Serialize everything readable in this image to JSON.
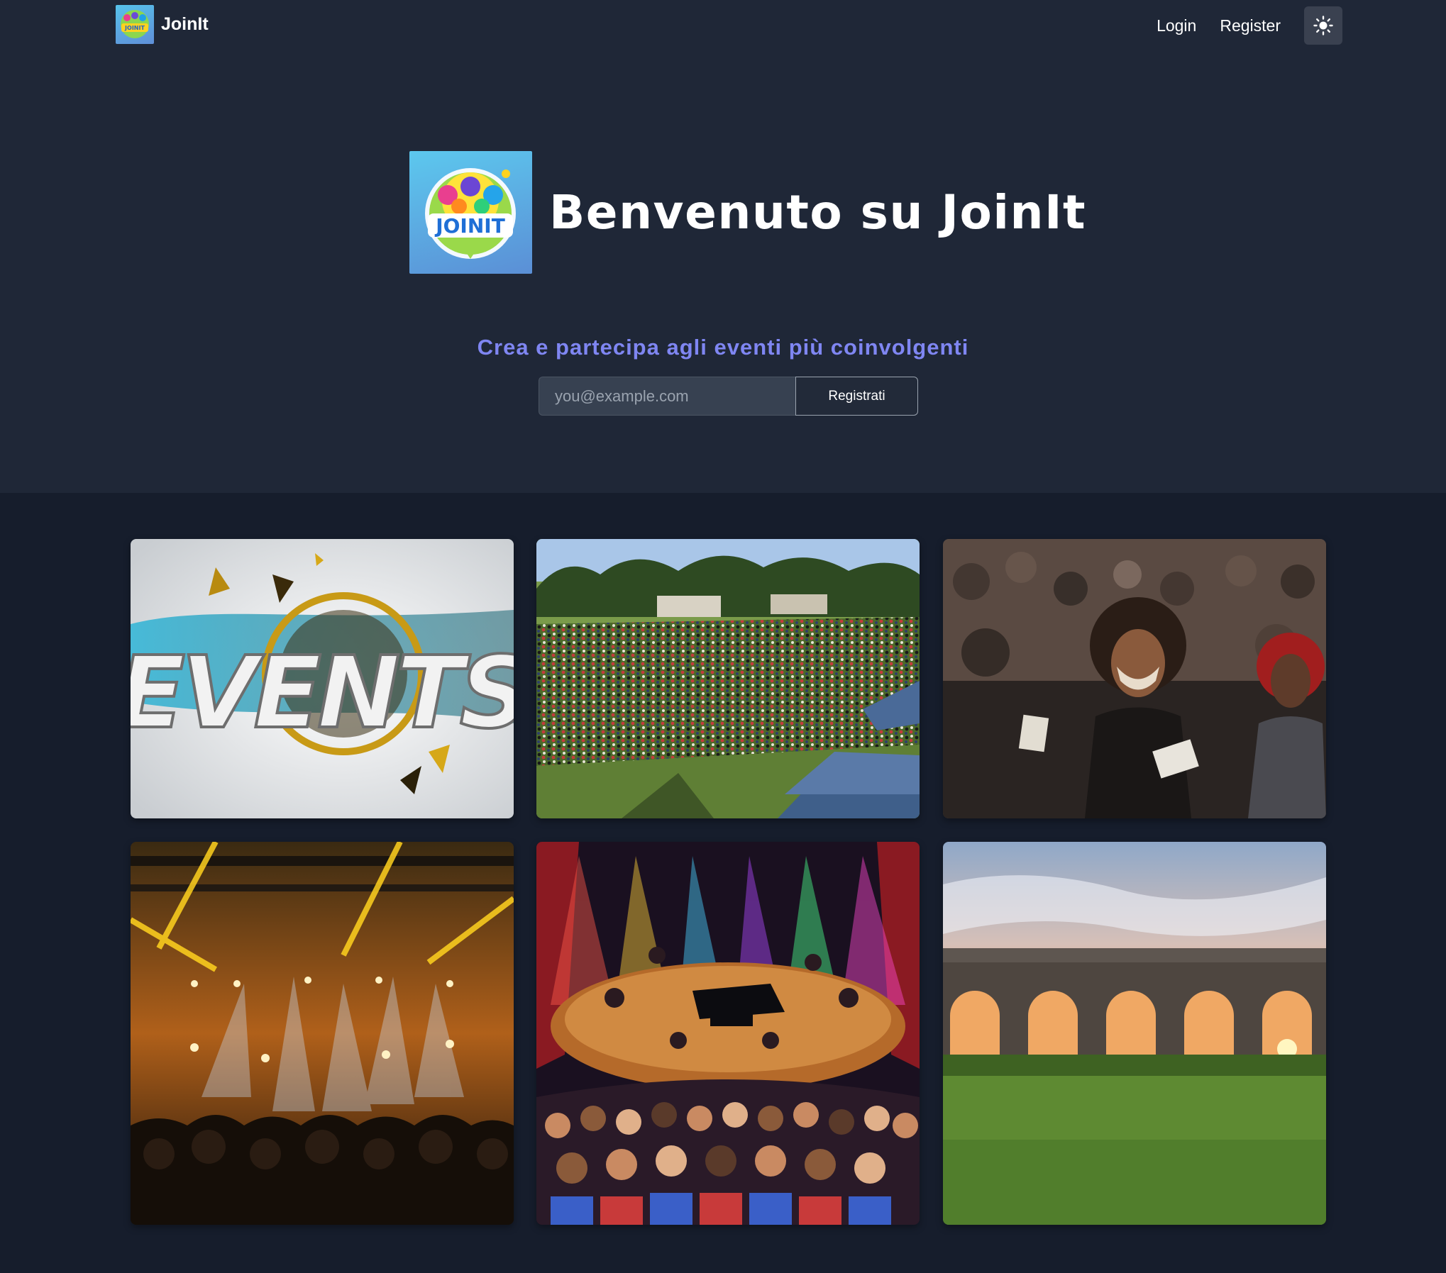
{
  "navbar": {
    "brand": "JoinIt",
    "logo_text": "JOINIT",
    "links": {
      "login": "Login",
      "register": "Register"
    },
    "theme_icon": "sun-icon"
  },
  "hero": {
    "title": "Benvenuto su JoinIt",
    "logo_text": "JOINIT",
    "subtitle": "Crea e partecipa agli eventi più coinvolgenti",
    "email_placeholder": "you@example.com",
    "submit_label": "Registrati"
  },
  "gallery": {
    "events_image_text": "EVENTS",
    "images": [
      "events-graphic",
      "outdoor-festival-crowd",
      "masked-protest-crowd",
      "concert-light-show",
      "jazz-stage-illustration",
      "aqueduct-sunset"
    ]
  },
  "colors": {
    "navbar_bg": "#1f2737",
    "page_bg": "#161d2c",
    "subtitle_accent": "#7f86f2",
    "input_bg": "#374151"
  }
}
